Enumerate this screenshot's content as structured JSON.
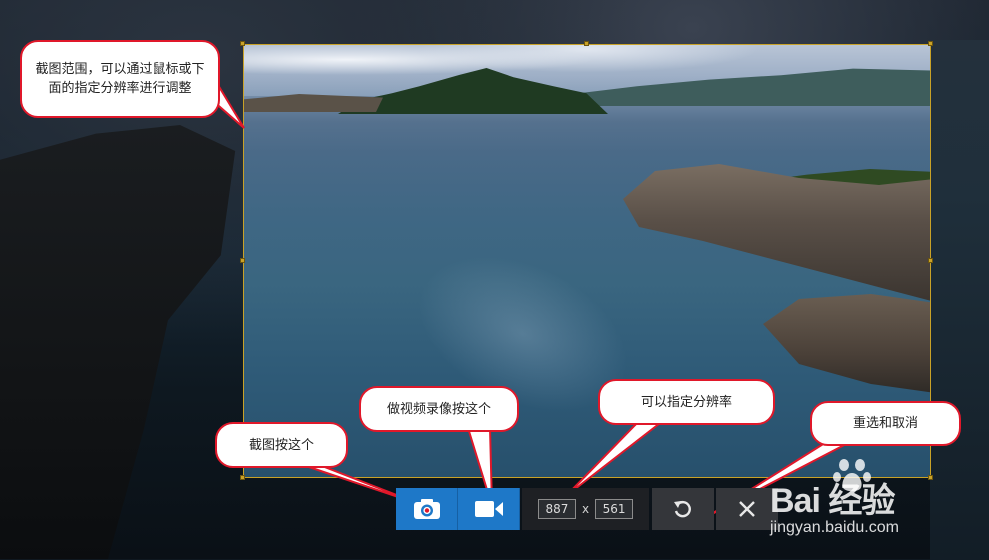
{
  "callouts": {
    "range": "截图范围，可以通过鼠标或下面的指定分辨率进行调整",
    "screenshot": "截图按这个",
    "video": "做视频录像按这个",
    "resolution": "可以指定分辨率",
    "reselect": "重选和取消"
  },
  "toolbar": {
    "camera_icon": "camera-icon",
    "video_icon": "video-camera-icon",
    "width": "887",
    "times": "x",
    "height": "561",
    "reselect_icon": "undo-icon",
    "cancel_icon": "close-icon"
  },
  "watermark": {
    "brand": "Bai  经验",
    "url": "jingyan.baidu.com"
  },
  "colors": {
    "accent_blue": "#1e78c8",
    "selection_border": "#c9a227",
    "callout_border": "#e0182a"
  }
}
